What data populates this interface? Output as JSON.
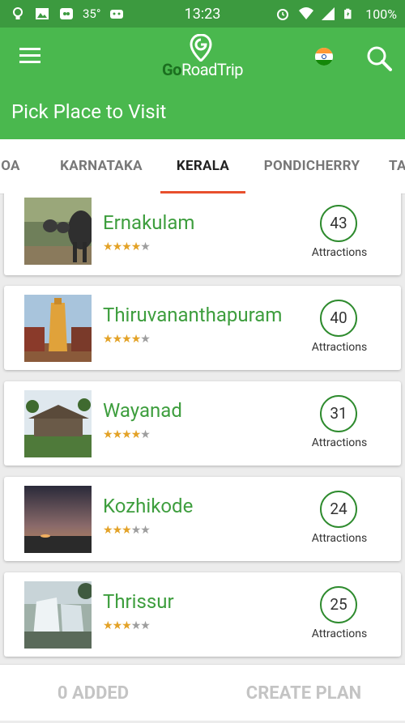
{
  "status_bar": {
    "temperature": "35°",
    "time": "13:23",
    "battery": "100%"
  },
  "toolbar": {
    "logo_text_1": "Go",
    "logo_text_2": "RoadTrip"
  },
  "page": {
    "heading": "Pick Place to Visit"
  },
  "tabs": [
    {
      "label": "OA"
    },
    {
      "label": "KARNATAKA"
    },
    {
      "label": "KERALA",
      "active": true
    },
    {
      "label": "PONDICHERRY"
    },
    {
      "label": "TA"
    }
  ],
  "places": [
    {
      "name": "Ernakulam",
      "rating": 4,
      "count": "43",
      "count_label": "Attractions"
    },
    {
      "name": "Thiruvananthapuram",
      "rating": 4,
      "count": "40",
      "count_label": "Attractions"
    },
    {
      "name": "Wayanad",
      "rating": 4,
      "count": "31",
      "count_label": "Attractions"
    },
    {
      "name": "Kozhikode",
      "rating": 3,
      "count": "24",
      "count_label": "Attractions"
    },
    {
      "name": "Thrissur",
      "rating": 3,
      "count": "25",
      "count_label": "Attractions"
    }
  ],
  "bottom_bar": {
    "added_label": "0 ADDED",
    "create_plan_label": "CREATE PLAN"
  },
  "colors": {
    "primary_green": "#4ab84e",
    "status_green": "#3c9a3f",
    "place_name_green": "#3e9e3e",
    "tab_indicator": "#e8502d",
    "star_gold": "#e3a227"
  }
}
